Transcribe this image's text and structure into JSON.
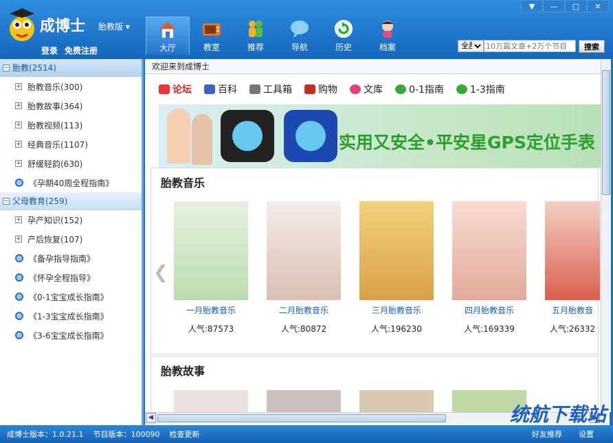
{
  "app": {
    "brand": "成博士",
    "edition": "胎教版"
  },
  "auth": {
    "login": "登录",
    "register": "免费注册"
  },
  "nav": [
    {
      "label": "大厅",
      "icon": "home-icon"
    },
    {
      "label": "教室",
      "icon": "tv-icon"
    },
    {
      "label": "推荐",
      "icon": "people-icon"
    },
    {
      "label": "导航",
      "icon": "chat-bubble-icon"
    },
    {
      "label": "历史",
      "icon": "refresh-icon"
    },
    {
      "label": "档案",
      "icon": "baby-icon"
    }
  ],
  "window": {
    "menu": "▼",
    "minimize": "—",
    "maximize": "□",
    "close": "✕"
  },
  "search": {
    "scope": "全部",
    "placeholder": "10万篇文章+2万个节目",
    "button": "搜索"
  },
  "sidebar": {
    "groups": [
      {
        "label": "胎教(2514)",
        "items": [
          {
            "label": "胎教音乐(300)",
            "type": "folder"
          },
          {
            "label": "胎教故事(364)",
            "type": "folder"
          },
          {
            "label": "胎教视频(113)",
            "type": "folder"
          },
          {
            "label": "经典音乐(1107)",
            "type": "folder"
          },
          {
            "label": "舒缓轻韵(630)",
            "type": "folder"
          },
          {
            "label": "《孕期40周全程指南》",
            "type": "link"
          }
        ]
      },
      {
        "label": "父母教育(259)",
        "items": [
          {
            "label": "孕产知识(152)",
            "type": "folder"
          },
          {
            "label": "产后恢复(107)",
            "type": "folder"
          },
          {
            "label": "《备孕指导指南》",
            "type": "link"
          },
          {
            "label": "《怀孕全程指导》",
            "type": "link"
          },
          {
            "label": "《0-1宝宝成长指南》",
            "type": "link"
          },
          {
            "label": "《1-3宝宝成长指南》",
            "type": "link"
          },
          {
            "label": "《3-6宝宝成长指南》",
            "type": "link"
          }
        ]
      }
    ]
  },
  "main": {
    "welcome": "欢迎来到成博士",
    "quick_links": [
      {
        "label": "论坛",
        "color": "#d9201c"
      },
      {
        "label": "百科",
        "color": "#3b63c8"
      },
      {
        "label": "工具箱",
        "color": "#555555"
      },
      {
        "label": "购物",
        "color": "#c03020"
      },
      {
        "label": "文库",
        "color": "#e0407a"
      },
      {
        "label": "0-1指南",
        "color": "#3aa83a"
      },
      {
        "label": "1-3指南",
        "color": "#3aa83a"
      }
    ],
    "banner_text": "实用又安全•平安星GPS定位手表",
    "sections": [
      {
        "title": "胎教音乐",
        "cards": [
          {
            "title": "一月胎教音乐",
            "popularity": "人气:87573",
            "color": "#cfe6c7"
          },
          {
            "title": "二月胎教音乐",
            "popularity": "人气:80872",
            "color": "#e9d8cf"
          },
          {
            "title": "三月胎教音乐",
            "popularity": "人气:196230",
            "color": "#e7c36a"
          },
          {
            "title": "四月胎教音乐",
            "popularity": "人气:169339",
            "color": "#efc7b9"
          },
          {
            "title": "五月胎教音",
            "popularity": "人气:26332",
            "color": "#d95f4f"
          }
        ]
      },
      {
        "title": "胎教故事"
      }
    ]
  },
  "status": {
    "app_version": "成博士版本：1.0.21.1",
    "program_version": "节目版本：100090",
    "check_update": "检查更新",
    "recommend": "好友推荐",
    "settings": "设置"
  },
  "watermark": "统航下载站"
}
